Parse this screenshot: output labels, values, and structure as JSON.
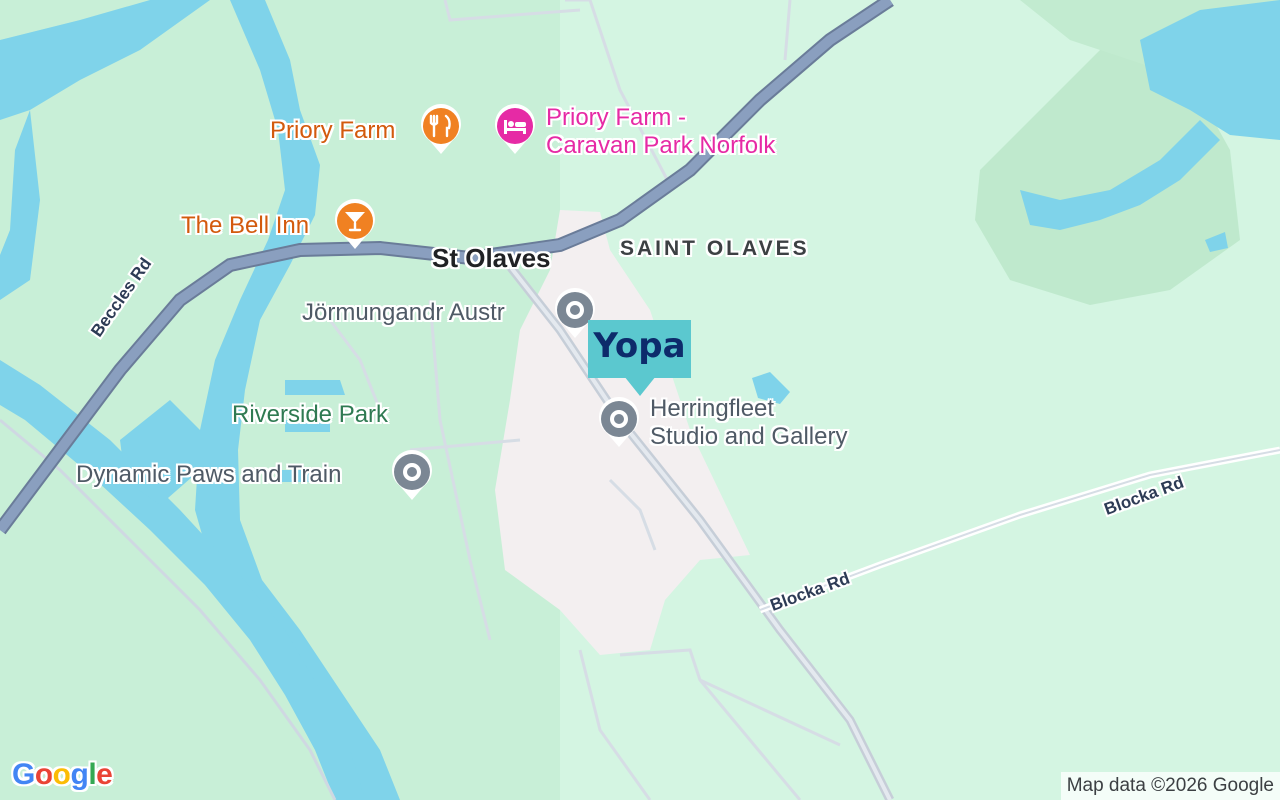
{
  "map": {
    "colors": {
      "land": "#c8efd7",
      "water": "#7fd3ea",
      "urban": "#f3eff0",
      "major_road": "#8a9fbf",
      "minor_road": "#d6dde5"
    },
    "places": {
      "town": "St Olaves",
      "area": "SAINT OLAVES",
      "park": "Riverside Park"
    },
    "roads": {
      "beccles": "Beccles Rd",
      "blocka_1": "Blocka Rd",
      "blocka_2": "Blocka Rd"
    },
    "pois": {
      "priory_farm": {
        "label": "Priory Farm",
        "icon": "restaurant-icon",
        "color": "#f08122"
      },
      "caravan_park": {
        "label_line1": "Priory Farm -",
        "label_line2": "Caravan Park Norfolk",
        "icon": "bed-icon",
        "color": "#e62aa5"
      },
      "bell_inn": {
        "label": "The Bell Inn",
        "icon": "cocktail-icon",
        "color": "#f08122"
      },
      "jormungandr": {
        "label": "Jörmungandr Austr",
        "icon": "place-icon",
        "color": "#7b8794"
      },
      "herringfleet": {
        "label_line1": "Herringfleet",
        "label_line2": "Studio and Gallery",
        "icon": "place-icon",
        "color": "#7b8794"
      },
      "dynamic_paws": {
        "label": "Dynamic Paws and Train",
        "icon": "place-icon",
        "color": "#7b8794"
      }
    },
    "ad": {
      "text": "Yopa",
      "icon": "yopa-logo-icon"
    },
    "attribution": "Map data ©2026 Google",
    "logo": {
      "letters": [
        "G",
        "o",
        "o",
        "g",
        "l",
        "e"
      ],
      "colors": [
        "#4285F4",
        "#EA4335",
        "#FBBC05",
        "#4285F4",
        "#34A853",
        "#EA4335"
      ]
    }
  }
}
